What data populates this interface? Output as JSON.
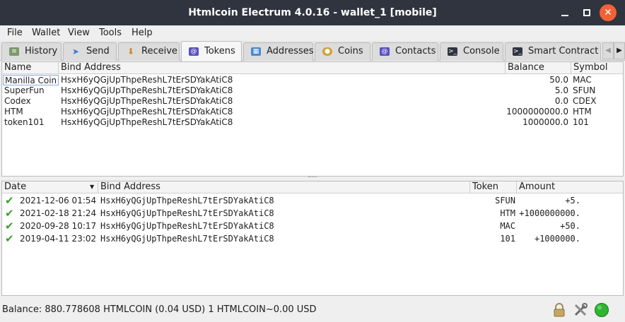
{
  "window": {
    "title": "Htmlcoin Electrum 4.0.16  -  wallet_1  [mobile]"
  },
  "menu": [
    "File",
    "Wallet",
    "View",
    "Tools",
    "Help"
  ],
  "tabs": [
    {
      "label": "History",
      "icon": "history-icon"
    },
    {
      "label": "Send",
      "icon": "send-icon"
    },
    {
      "label": "Receive",
      "icon": "receive-icon"
    },
    {
      "label": "Tokens",
      "icon": "tokens-icon",
      "active": true
    },
    {
      "label": "Addresses",
      "icon": "addresses-icon"
    },
    {
      "label": "Coins",
      "icon": "coins-icon"
    },
    {
      "label": "Contacts",
      "icon": "contacts-icon"
    },
    {
      "label": "Console",
      "icon": "console-icon"
    },
    {
      "label": "Smart Contract",
      "icon": "smart-contract-icon"
    }
  ],
  "tokens_table": {
    "headers": {
      "name": "Name",
      "bind_address": "Bind Address",
      "balance": "Balance",
      "symbol": "Symbol"
    },
    "rows": [
      {
        "name": "Manilla Coin",
        "bind_address": "HsxH6yQGjUpThpeReshL7tErSDYakAtiC8",
        "balance": "50.0",
        "symbol": "MAC"
      },
      {
        "name": "SuperFun",
        "bind_address": "HsxH6yQGjUpThpeReshL7tErSDYakAtiC8",
        "balance": "5.0",
        "symbol": "SFUN"
      },
      {
        "name": "Codex",
        "bind_address": "HsxH6yQGjUpThpeReshL7tErSDYakAtiC8",
        "balance": "0.0",
        "symbol": "CDEX"
      },
      {
        "name": "HTM",
        "bind_address": "HsxH6yQGjUpThpeReshL7tErSDYakAtiC8",
        "balance": "1000000000.0",
        "symbol": "HTM"
      },
      {
        "name": "token101",
        "bind_address": "HsxH6yQGjUpThpeReshL7tErSDYakAtiC8",
        "balance": "1000000.0",
        "symbol": "101"
      }
    ]
  },
  "history_table": {
    "headers": {
      "date": "Date",
      "bind_address": "Bind Address",
      "token": "Token",
      "amount": "Amount"
    },
    "rows": [
      {
        "date": "2021-12-06 01:54",
        "bind_address": "HsxH6yQGjUpThpeReshL7tErSDYakAtiC8",
        "token": "SFUN",
        "amount": "+5."
      },
      {
        "date": "2021-02-18 21:24",
        "bind_address": "HsxH6yQGjUpThpeReshL7tErSDYakAtiC8",
        "token": "HTM",
        "amount": "+1000000000."
      },
      {
        "date": "2020-09-28 10:17",
        "bind_address": "HsxH6yQGjUpThpeReshL7tErSDYakAtiC8",
        "token": "MAC",
        "amount": "+50."
      },
      {
        "date": "2019-04-11 23:02",
        "bind_address": "HsxH6yQGjUpThpeReshL7tErSDYakAtiC8",
        "token": "101",
        "amount": "+1000000."
      }
    ]
  },
  "status": {
    "text": "Balance: 880.778608 HTMLCOIN (0.04 USD)  1 HTMLCOIN~0.00 USD"
  },
  "colors": {
    "titlebar": "#2f343f",
    "close_button": "#f46036",
    "check": "#3aa02b",
    "network_ok": "#2fb52f"
  }
}
